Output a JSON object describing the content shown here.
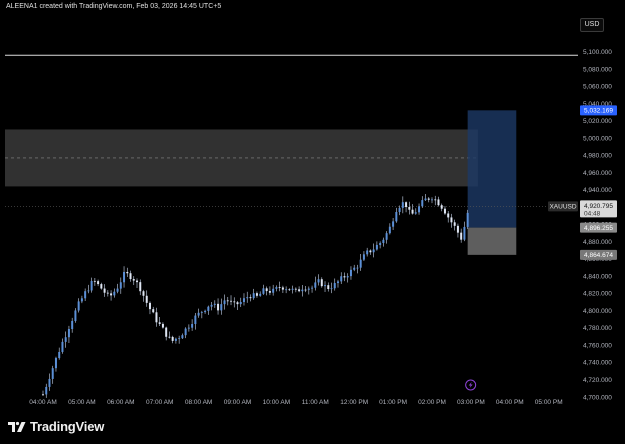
{
  "header": {
    "title": "ALEENA1 created with TradingView.com, Feb 03, 2026 14:45 UTC+5"
  },
  "toolbar": {
    "currency": "USD"
  },
  "brand": {
    "name": "TradingView",
    "icon": "tradingview-logo-icon"
  },
  "colors": {
    "background": "#000000",
    "candle": "#5b8fd6",
    "wick": "#c8d6ee",
    "zone": "#3a3a3a",
    "target_box": "#1d3a66",
    "stop_box": "#6f6f6f",
    "price_line": "#2a2a2a"
  },
  "chart_data": {
    "type": "candlestick",
    "symbol": "XAUUSD",
    "ylim": [
      4690,
      5110
    ],
    "y_ticks": [
      4700,
      4720,
      4740,
      4760,
      4780,
      4800,
      4820,
      4840,
      4860,
      4880,
      4900,
      4920,
      4940,
      4960,
      4980,
      5000,
      5020,
      5040,
      5060,
      5080,
      5100
    ],
    "y_tick_labels": [
      "4,700.000",
      "4,720.000",
      "4,740.000",
      "4,760.000",
      "4,780.000",
      "4,800.000",
      "4,820.000",
      "4,840.000",
      "4,860.000",
      "4,880.000",
      "4,900.000",
      "4,920.000",
      "4,940.000",
      "4,960.000",
      "4,980.000",
      "5,000.000",
      "5,020.000",
      "5,040.000",
      "5,060.000",
      "5,080.000",
      "5,100.000"
    ],
    "x_ticks": [
      "04:00 AM",
      "05:00 AM",
      "06:00 AM",
      "07:00 AM",
      "08:00 AM",
      "09:00 AM",
      "10:00 AM",
      "11:00 AM",
      "12:00 PM",
      "01:00 PM",
      "02:00 PM",
      "03:00 PM",
      "04:00 PM",
      "05:00 PM"
    ],
    "price_path": [
      [
        4.0,
        4703
      ],
      [
        4.2,
        4728
      ],
      [
        4.45,
        4758
      ],
      [
        4.7,
        4785
      ],
      [
        4.9,
        4806
      ],
      [
        5.1,
        4822
      ],
      [
        5.3,
        4835
      ],
      [
        5.5,
        4826
      ],
      [
        5.7,
        4815
      ],
      [
        5.9,
        4826
      ],
      [
        6.1,
        4843
      ],
      [
        6.3,
        4839
      ],
      [
        6.5,
        4826
      ],
      [
        6.7,
        4806
      ],
      [
        6.9,
        4790
      ],
      [
        7.1,
        4777
      ],
      [
        7.3,
        4764
      ],
      [
        7.5,
        4770
      ],
      [
        7.7,
        4780
      ],
      [
        7.9,
        4792
      ],
      [
        8.1,
        4800
      ],
      [
        8.3,
        4808
      ],
      [
        8.5,
        4803
      ],
      [
        8.7,
        4814
      ],
      [
        8.9,
        4806
      ],
      [
        9.1,
        4810
      ],
      [
        9.3,
        4818
      ],
      [
        9.5,
        4816
      ],
      [
        9.7,
        4824
      ],
      [
        9.9,
        4822
      ],
      [
        10.1,
        4828
      ],
      [
        10.3,
        4826
      ],
      [
        10.5,
        4822
      ],
      [
        10.7,
        4828
      ],
      [
        10.9,
        4826
      ],
      [
        11.1,
        4834
      ],
      [
        11.3,
        4826
      ],
      [
        11.5,
        4830
      ],
      [
        11.7,
        4838
      ],
      [
        11.9,
        4845
      ],
      [
        12.1,
        4853
      ],
      [
        12.3,
        4866
      ],
      [
        12.5,
        4872
      ],
      [
        12.7,
        4880
      ],
      [
        12.9,
        4894
      ],
      [
        13.1,
        4920
      ],
      [
        13.3,
        4926
      ],
      [
        13.45,
        4910
      ],
      [
        13.6,
        4916
      ],
      [
        13.8,
        4928
      ],
      [
        14.0,
        4932
      ],
      [
        14.15,
        4926
      ],
      [
        14.3,
        4918
      ],
      [
        14.45,
        4906
      ],
      [
        14.6,
        4896
      ],
      [
        14.75,
        4884
      ],
      [
        14.85,
        4900
      ],
      [
        14.95,
        4920
      ]
    ],
    "supply_zone": {
      "top": 5010,
      "bottom": 4944,
      "mid": 4977,
      "start": "03:00 AM",
      "end": "03:00 PM"
    },
    "position": {
      "entry": 4896.255,
      "target": 5032.169,
      "stop": 4864.674,
      "start": "02:55 PM",
      "end": "04:10 PM"
    },
    "horizontal_line": 5096,
    "last_price": {
      "symbol_label": "XAUUSD",
      "price": "4,920.795",
      "countdown": "04:48"
    },
    "price_labels": {
      "target": "5,032.169",
      "entry": "4,896.255",
      "stop": "4,864.674"
    }
  }
}
